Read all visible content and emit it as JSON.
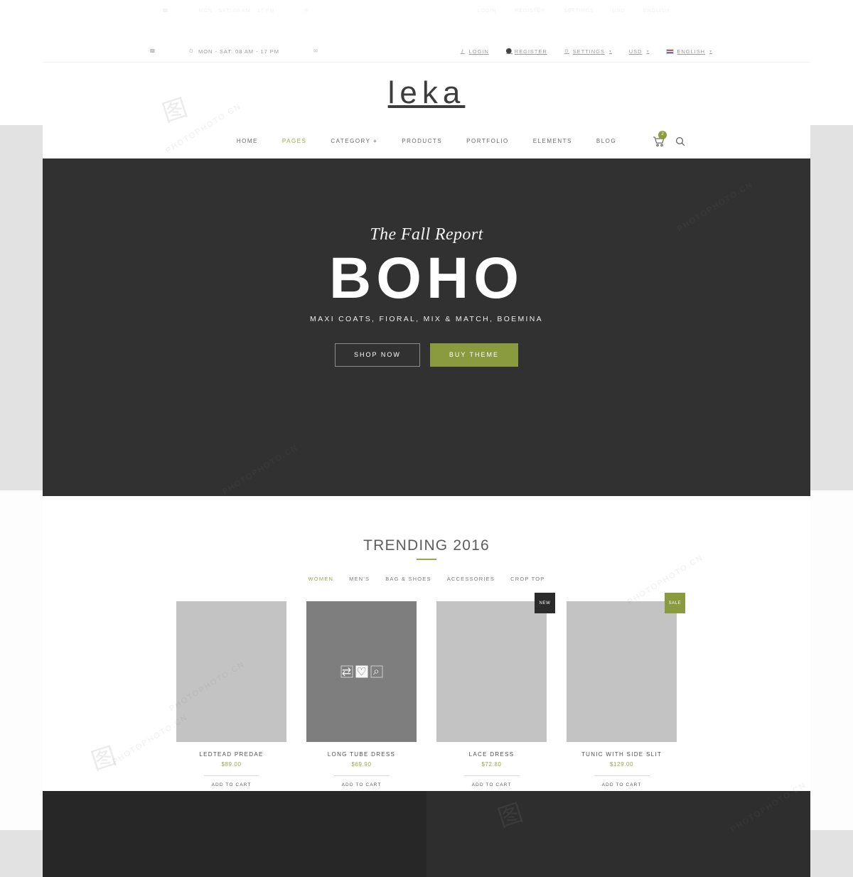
{
  "topbar": {
    "phone_icon": "phone-icon",
    "hours_icon": "clock-icon",
    "hours": "MON - SAT: 08 AM - 17 PM",
    "mail_icon": "envelope-icon",
    "links": [
      {
        "label": "LOGIN",
        "icon": "key-icon",
        "caret": ""
      },
      {
        "label": "REGISTER",
        "icon": "user-icon",
        "caret": ""
      },
      {
        "label": "SETTINGS",
        "icon": "gear-icon",
        "caret": "⌄"
      },
      {
        "label": "USD",
        "icon": "",
        "caret": "⌄"
      },
      {
        "label": "ENGLISH",
        "icon": "flag-icon",
        "caret": "⌄"
      }
    ]
  },
  "brand": {
    "logo": "leka"
  },
  "nav": {
    "items": [
      {
        "label": "HOME",
        "active": false
      },
      {
        "label": "PAGES",
        "active": true
      },
      {
        "label": "CATEGORY +",
        "active": false
      },
      {
        "label": "PRODUCTS",
        "active": false
      },
      {
        "label": "PORTFOLIO",
        "active": false
      },
      {
        "label": "ELEMENTS",
        "active": false
      },
      {
        "label": "BLOG",
        "active": false
      }
    ],
    "cart_icon": "shopping-cart-icon",
    "cart_count": "2",
    "search_icon": "search-icon"
  },
  "hero": {
    "eyebrow": "The Fall Report",
    "title": "BOHO",
    "subtitle": "MAXI COATS, FIORAL, MIX & MATCH, BOEMINA",
    "primary_button": "SHOP NOW",
    "secondary_button": "BUY THEME",
    "background_color": "#313131",
    "accent_color": "#8a9a3f"
  },
  "trending": {
    "title": "TRENDING 2016",
    "accent_color": "#9aa84b",
    "filters": [
      {
        "label": "WOMEN",
        "active": true
      },
      {
        "label": "MEN'S",
        "active": false
      },
      {
        "label": "BAG & SHOES",
        "active": false
      },
      {
        "label": "ACCESSORIES",
        "active": false
      },
      {
        "label": "CROP TOP",
        "active": false
      }
    ],
    "add_to_cart_label": "ADD TO CART",
    "products": [
      {
        "name": "LEDTEAD PREDAE",
        "price": "$89.00",
        "badge": "",
        "badge_type": "",
        "hovered": false
      },
      {
        "name": "LONG TUBE DRESS",
        "price": "$69.90",
        "badge": "",
        "badge_type": "",
        "hovered": true,
        "actions": [
          {
            "icon": "compare-icon",
            "glyph": "⇄",
            "active": false
          },
          {
            "icon": "heart-icon",
            "glyph": "♡",
            "active": true
          },
          {
            "icon": "search-icon",
            "glyph": "⌕",
            "active": false
          }
        ]
      },
      {
        "name": "LACE DRESS",
        "price": "$72.80",
        "badge": "NEW",
        "badge_type": "new",
        "hovered": false
      },
      {
        "name": "TUNIC WITH SIDE SLIT",
        "price": "$129.00",
        "badge": "SALE",
        "badge_type": "sale",
        "hovered": false
      }
    ]
  },
  "watermark": {
    "text": "PHOTOPHOTO.CN"
  }
}
